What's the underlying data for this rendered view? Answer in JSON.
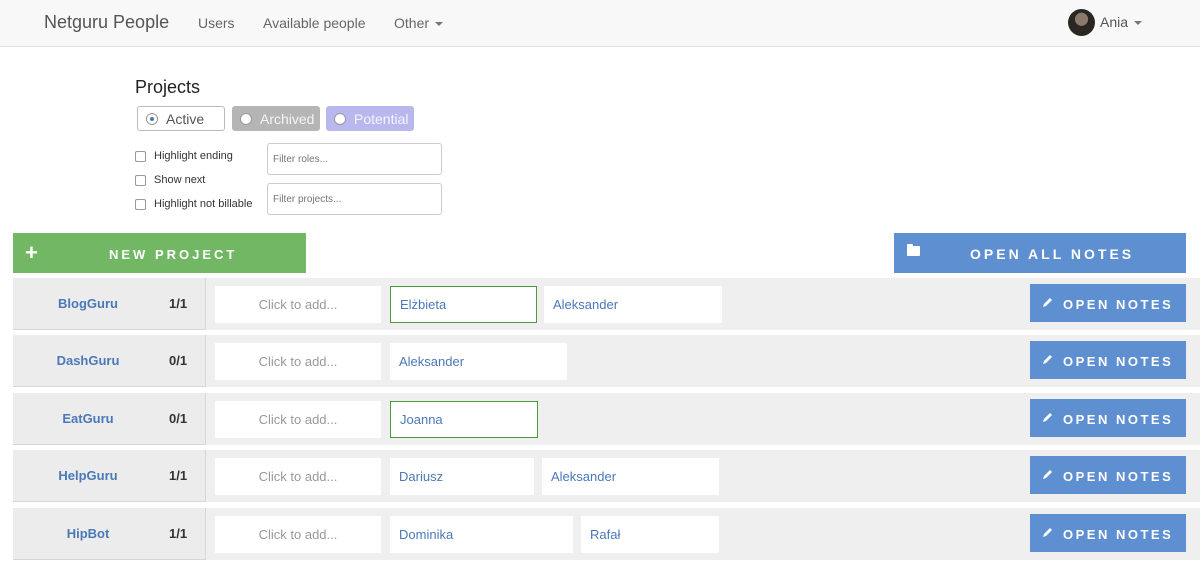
{
  "navbar": {
    "brand": "Netguru People",
    "links": [
      "Users",
      "Available people",
      "Other"
    ],
    "user": "Ania"
  },
  "projects": {
    "title": "Projects",
    "filters": {
      "active": "Active",
      "archived": "Archived",
      "potential": "Potential"
    },
    "checkboxes": [
      "Highlight ending",
      "Show next",
      "Highlight not billable"
    ],
    "roles_placeholder": "Filter roles...",
    "projects_placeholder": "Filter projects..."
  },
  "actions": {
    "new_project": "NEW PROJECT",
    "new_project_icon": "plus-icon",
    "open_all_notes": "OPEN ALL NOTES",
    "open_all_icon": "folder-icon"
  },
  "rows": [
    {
      "name": "BlogGuru",
      "count": "1/1",
      "add": "Click to add...",
      "people": [
        "Elżbieta",
        "Aleksander"
      ],
      "notes": "OPEN NOTES"
    },
    {
      "name": "DashGuru",
      "count": "0/1",
      "add": "Click to add...",
      "people": [
        "Aleksander"
      ],
      "notes": "OPEN NOTES"
    },
    {
      "name": "EatGuru",
      "count": "0/1",
      "add": "Click to add...",
      "people": [
        "Joanna"
      ],
      "notes": "OPEN NOTES"
    },
    {
      "name": "HelpGuru",
      "count": "1/1",
      "add": "Click to add...",
      "people": [
        "Dariusz",
        "Aleksander"
      ],
      "notes": "OPEN NOTES"
    },
    {
      "name": "HipBot",
      "count": "1/1",
      "add": "Click to add...",
      "people": [
        "Dominika",
        "Rafał"
      ],
      "notes": "OPEN NOTES"
    }
  ],
  "colors": {
    "accent_blue": "#5e8fd0",
    "accent_green": "#72b864",
    "link_blue": "#4a78b8"
  }
}
